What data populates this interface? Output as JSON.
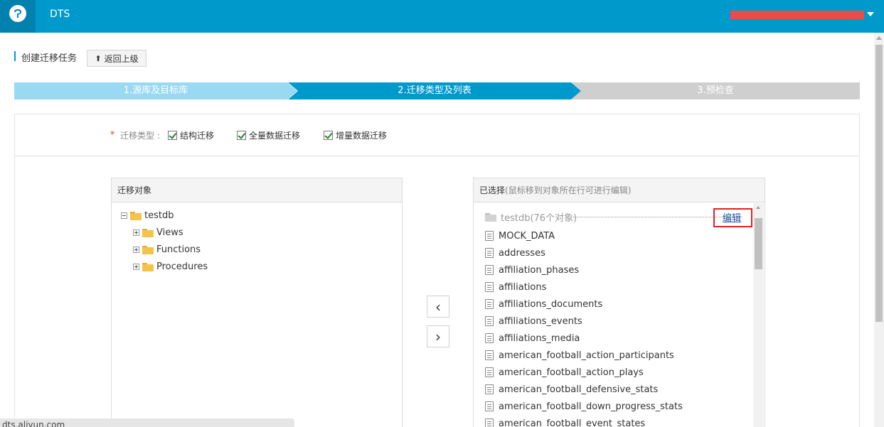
{
  "header": {
    "app_title": "DTS",
    "logo_icon": "aliyun-cloud-logo-icon",
    "user_bar_color": "#e84c4c"
  },
  "page": {
    "title": "创建迁移任务",
    "back_button": "返回上级",
    "back_icon": "up-arrow-icon"
  },
  "steps": [
    {
      "label": "1.源库及目标库",
      "state": "done",
      "color": "#99daf2"
    },
    {
      "label": "2.迁移类型及列表",
      "state": "active",
      "color": "#0099cc"
    },
    {
      "label": "3.预检查",
      "state": "pending",
      "color": "#cfcfcf"
    }
  ],
  "migration_type": {
    "required_mark": "*",
    "label": "迁移类型 :",
    "options": [
      {
        "label": "结构迁移",
        "checked": true
      },
      {
        "label": "全量数据迁移",
        "checked": true
      },
      {
        "label": "增量数据迁移",
        "checked": true
      }
    ]
  },
  "source_panel": {
    "title": "迁移对象",
    "root": "testdb",
    "children": [
      "Views",
      "Functions",
      "Procedures"
    ]
  },
  "selected_panel": {
    "title": "已选择",
    "hint": "(鼠标移到对象所在行可进行编辑)",
    "root": "testdb(76个对象)",
    "edit_link": "编辑",
    "items": [
      "MOCK_DATA",
      "addresses",
      "affiliation_phases",
      "affiliations",
      "affiliations_documents",
      "affiliations_events",
      "affiliations_media",
      "american_football_action_participants",
      "american_football_action_plays",
      "american_football_defensive_stats",
      "american_football_down_progress_stats",
      "american_football_event_states"
    ]
  },
  "move_buttons": {
    "left_label": "‹",
    "right_label": "›"
  },
  "status_bar": {
    "url": "dts.aliyun.com"
  }
}
